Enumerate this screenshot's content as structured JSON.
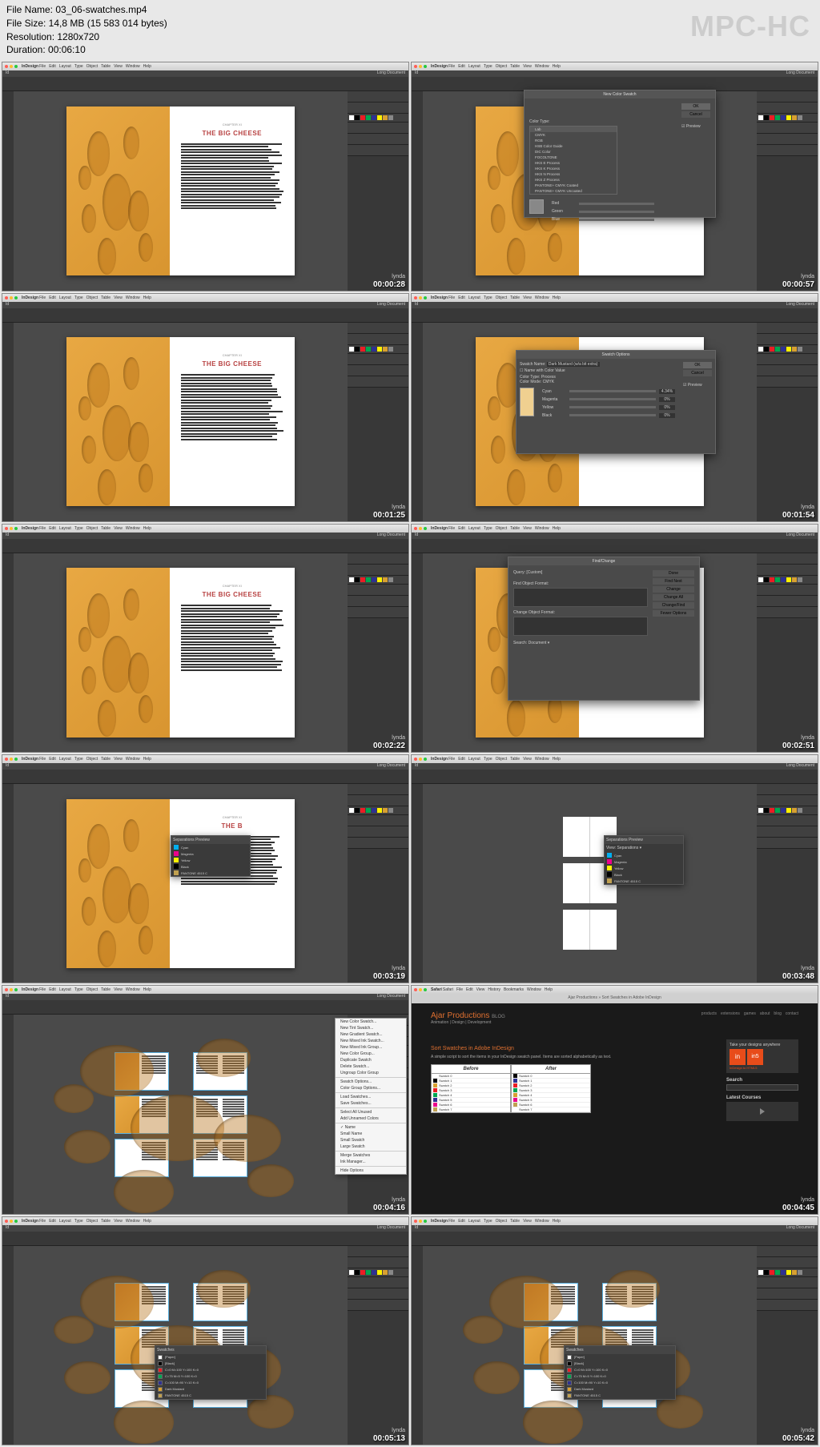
{
  "header": {
    "filename": "File Name: 03_06-swatches.mp4",
    "filesize": "File Size: 14,8 MB (15 583 014 bytes)",
    "resolution": "Resolution: 1280x720",
    "duration": "Duration: 00:06:10",
    "watermark": "MPC-HC"
  },
  "common": {
    "app_name": "InDesign",
    "menu": [
      "File",
      "Edit",
      "Layout",
      "Type",
      "Object",
      "Table",
      "View",
      "Window",
      "Help"
    ],
    "safari_menu": [
      "Safari",
      "File",
      "Edit",
      "View",
      "History",
      "Bookmarks",
      "Window",
      "Help"
    ],
    "doc_title": "Long Document",
    "chapter": "CHAPTER XI",
    "page_title": "THE BIG CHEESE",
    "lynda": "lynda"
  },
  "thumbs": [
    {
      "ts": "00:00:28",
      "type": "doc"
    },
    {
      "ts": "00:00:57",
      "type": "new_swatch"
    },
    {
      "ts": "00:01:25",
      "type": "doc"
    },
    {
      "ts": "00:01:54",
      "type": "swatch_options"
    },
    {
      "ts": "00:02:22",
      "type": "doc"
    },
    {
      "ts": "00:02:51",
      "type": "find_change"
    },
    {
      "ts": "00:03:19",
      "type": "swatch_panel"
    },
    {
      "ts": "00:03:48",
      "type": "spreads"
    },
    {
      "ts": "00:04:16",
      "type": "layout_menu"
    },
    {
      "ts": "00:04:45",
      "type": "web"
    },
    {
      "ts": "00:05:13",
      "type": "layout_panel"
    },
    {
      "ts": "00:05:42",
      "type": "layout_panel"
    }
  ],
  "new_swatch": {
    "title": "New Color Swatch",
    "color_type": "Color Type:",
    "options": [
      "Lab",
      "CMYK",
      "RGB",
      "HSB Color Guide",
      "DIC Color",
      "FOCOLTONE",
      "HKS E Process",
      "HKS K Process",
      "HKS N Process",
      "HKS Z Process",
      "PANTONE+ CMYK Coated",
      "PANTONE+ CMYK Uncoated"
    ],
    "ok": "OK",
    "cancel": "Cancel",
    "preview": "Preview"
  },
  "swatch_options": {
    "title": "Swatch Options",
    "name_label": "Swatch Name:",
    "name_value": "Dark Mustard (w/a bit extra)",
    "name_with": "Name with Color Value",
    "color_type": "Color Type:",
    "color_type_val": "Process",
    "color_mode": "Color Mode:",
    "color_mode_val": "CMYK",
    "sliders": [
      {
        "label": "Cyan",
        "val": "4.34%"
      },
      {
        "label": "Magenta",
        "val": "0%"
      },
      {
        "label": "Yellow",
        "val": "0%"
      },
      {
        "label": "Black",
        "val": "0%"
      }
    ],
    "ok": "OK",
    "cancel": "Cancel",
    "preview": "Preview"
  },
  "find_change": {
    "title": "Find/Change",
    "tabs": [
      "Query:",
      "[Custom]"
    ],
    "find_format": "Find Object Format:",
    "change_format": "Change Object Format:",
    "search": "Search:",
    "search_val": "Document",
    "buttons": [
      "Done",
      "Find Next",
      "Change",
      "Change All",
      "Change/Find",
      "Fewer Options"
    ]
  },
  "swatch_panel": {
    "title": "Separations Preview",
    "rows": [
      {
        "color": "#00aeef",
        "label": "Cyan"
      },
      {
        "color": "#ec008c",
        "label": "Magenta"
      },
      {
        "color": "#fff200",
        "label": "Yellow"
      },
      {
        "color": "#000000",
        "label": "Black"
      },
      {
        "color": "#c0a050",
        "label": "PANTONE 4515 C"
      }
    ]
  },
  "context_menu": {
    "items": [
      "New Color Swatch...",
      "New Tint Swatch...",
      "New Gradient Swatch...",
      "New Mixed Ink Swatch...",
      "New Mixed Ink Group...",
      "New Color Group...",
      "Duplicate Swatch",
      "Delete Swatch...",
      "Ungroup Color Group",
      "-",
      "Swatch Options...",
      "Color Group Options...",
      "-",
      "Load Swatches...",
      "Save Swatches...",
      "-",
      "Select All Unused",
      "Add Unnamed Colors",
      "-",
      "✓ Name",
      "Small Name",
      "Small Swatch",
      "Large Swatch",
      "-",
      "Merge Swatches",
      "Ink Manager...",
      "-",
      "Hide Options"
    ]
  },
  "web": {
    "safari_tab": "Ajar Productions » Sort Swatches in Adobe InDesign",
    "site_title": "Ajar Productions",
    "site_tag": "BLOG",
    "subtitle": "Animation | Design | Development",
    "nav": [
      "products",
      "extensions",
      "games",
      "about",
      "blog",
      "contact"
    ],
    "h2": "Sort Swatches in Adobe InDesign",
    "blurb": "A simple script to sort the items in your InDesign swatch panel. Items are sorted alphabetically as text.",
    "before": "Before",
    "after": "After",
    "sidebar_box1": "Take your designs anywhere",
    "sidebar_product": "in5",
    "sidebar_tag": "InDesign to HTML5",
    "search": "Search",
    "latest": "Latest Courses"
  },
  "layout_panel": {
    "swatches": [
      {
        "color": "#ffffff",
        "label": "[Paper]"
      },
      {
        "color": "#000000",
        "label": "[Black]"
      },
      {
        "color": "#ed1c24",
        "label": "C=0 M=100 Y=100 K=0"
      },
      {
        "color": "#00a651",
        "label": "C=75 M=5 Y=100 K=0"
      },
      {
        "color": "#2e3192",
        "label": "C=100 M=90 Y=10 K=0"
      },
      {
        "color": "#d8a030",
        "label": "Dark Mustard"
      },
      {
        "color": "#c0a050",
        "label": "PANTONE 4515 C"
      }
    ]
  }
}
